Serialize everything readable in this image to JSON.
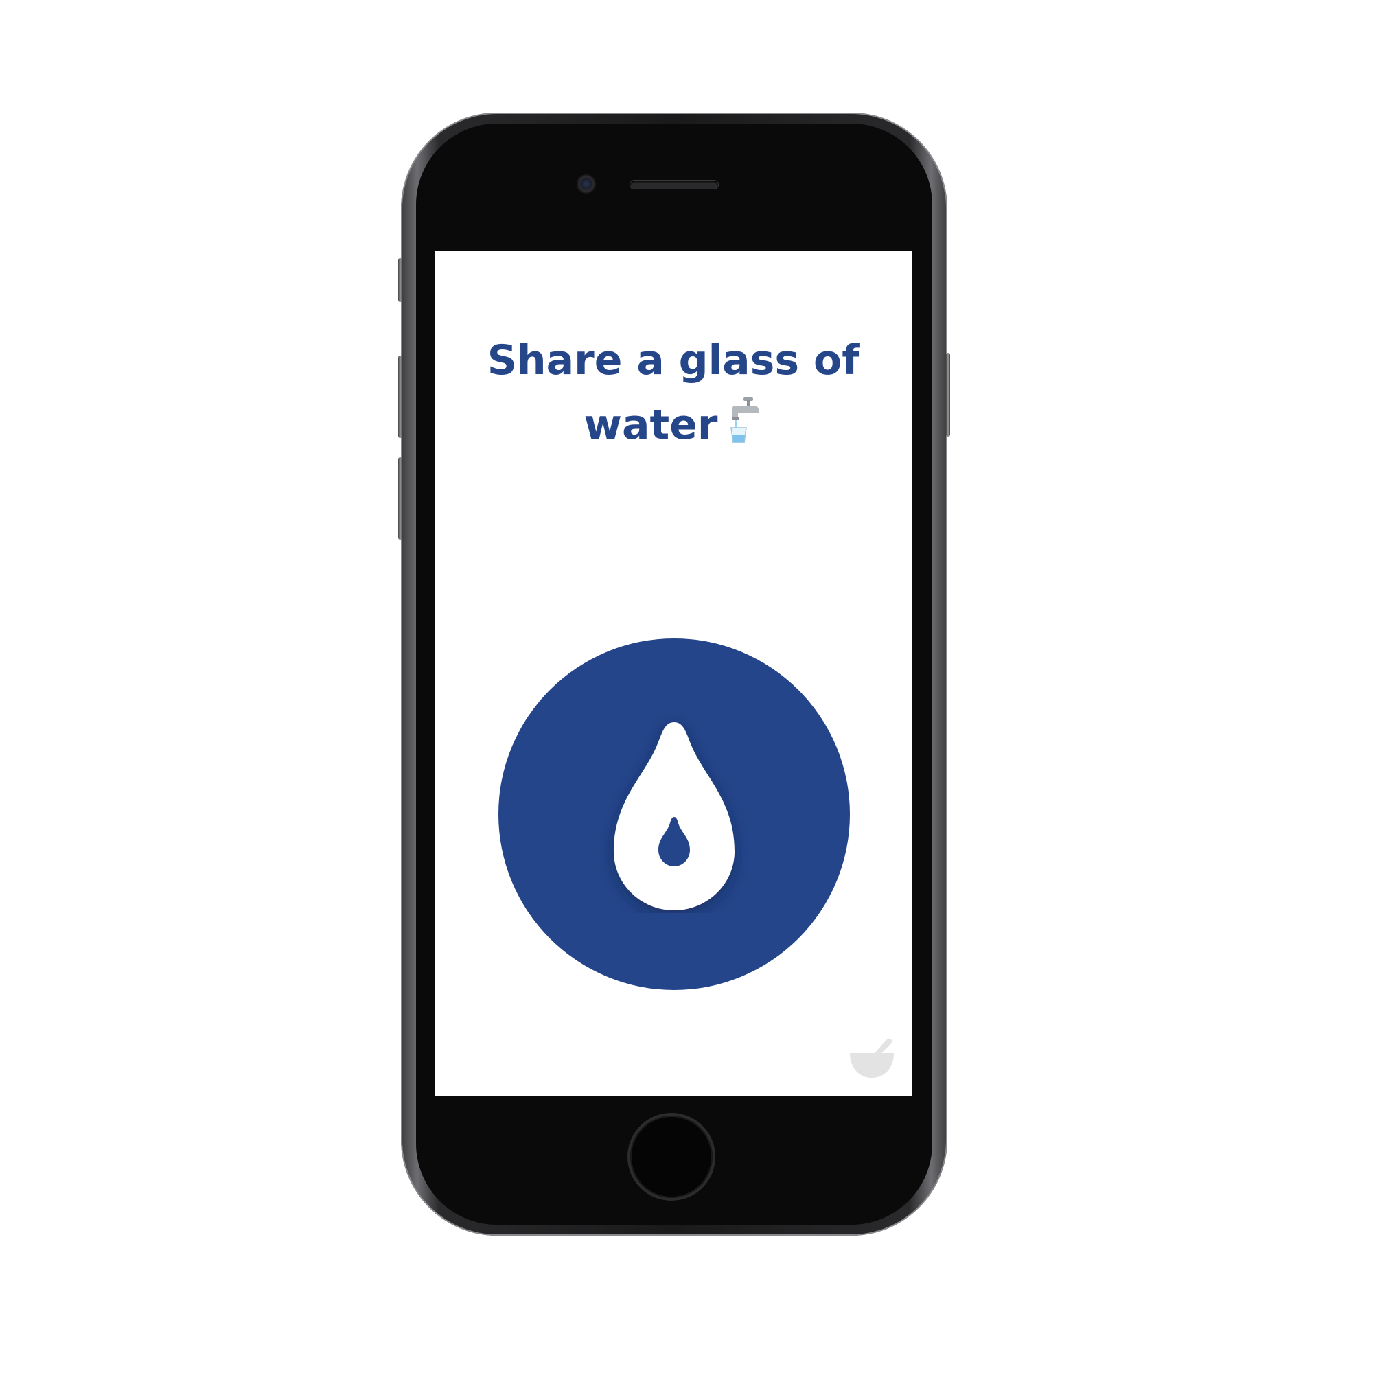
{
  "screen": {
    "headline": {
      "line1": "Share a glass of",
      "line2": "water"
    },
    "headline_emoji_icon": "faucet-glass-icon",
    "main_button_icon": "water-drop-icon",
    "corner_icon": "mortar-pestle-icon"
  },
  "colors": {
    "accent": "#24458a",
    "headline": "#26468a",
    "corner_icon": "#e3e3e3",
    "screen_background": "#ffffff",
    "device_frame": "#1a1a1b"
  }
}
